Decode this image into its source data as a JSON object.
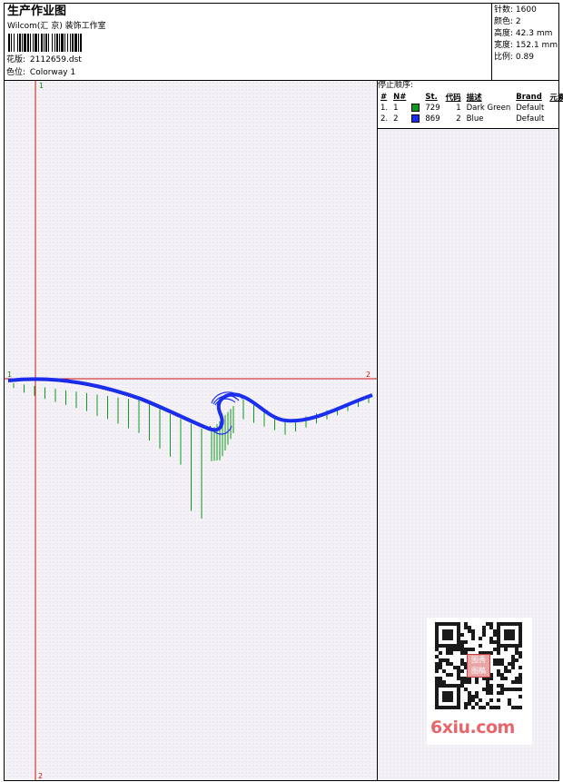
{
  "header": {
    "title": "生产作业图",
    "company": "Wilcom(汇 京) 装饰工作室",
    "design_label": "花版:",
    "design_value": "2112659.dst",
    "colorway_label": "色位:",
    "colorway_value": "Colorway 1"
  },
  "stats": {
    "stitches_label": "针数:",
    "stitches_value": "1600",
    "colors_label": "颜色:",
    "colors_value": "2",
    "height_label": "高度:",
    "height_value": "42.3 mm",
    "width_label": "宽度:",
    "width_value": "152.1 mm",
    "scale_label": "比例:",
    "scale_value": "0.89"
  },
  "stop_sequence": {
    "title": "停止顺序:",
    "columns": [
      "#",
      "N#",
      "St.",
      "代码",
      "描述",
      "Brand",
      "元素"
    ],
    "rows": [
      {
        "num": "1.",
        "n": "1",
        "st": "729",
        "code": "1",
        "desc": "Dark Green",
        "brand": "Default",
        "color": "#0d9b1a"
      },
      {
        "num": "2.",
        "n": "2",
        "st": "869",
        "code": "2",
        "desc": "Blue",
        "brand": "Default",
        "color": "#1b2ef0"
      }
    ]
  },
  "markers": {
    "top_left": "1",
    "bottom_left": "2",
    "right": "2",
    "left": "1"
  },
  "watermark": {
    "site": "6xiu.com",
    "seal": "图秀图稿"
  },
  "colors": {
    "thread_green": "#0d9b1a",
    "thread_blue": "#1b2ef0",
    "guide_red": "#cc1111"
  }
}
